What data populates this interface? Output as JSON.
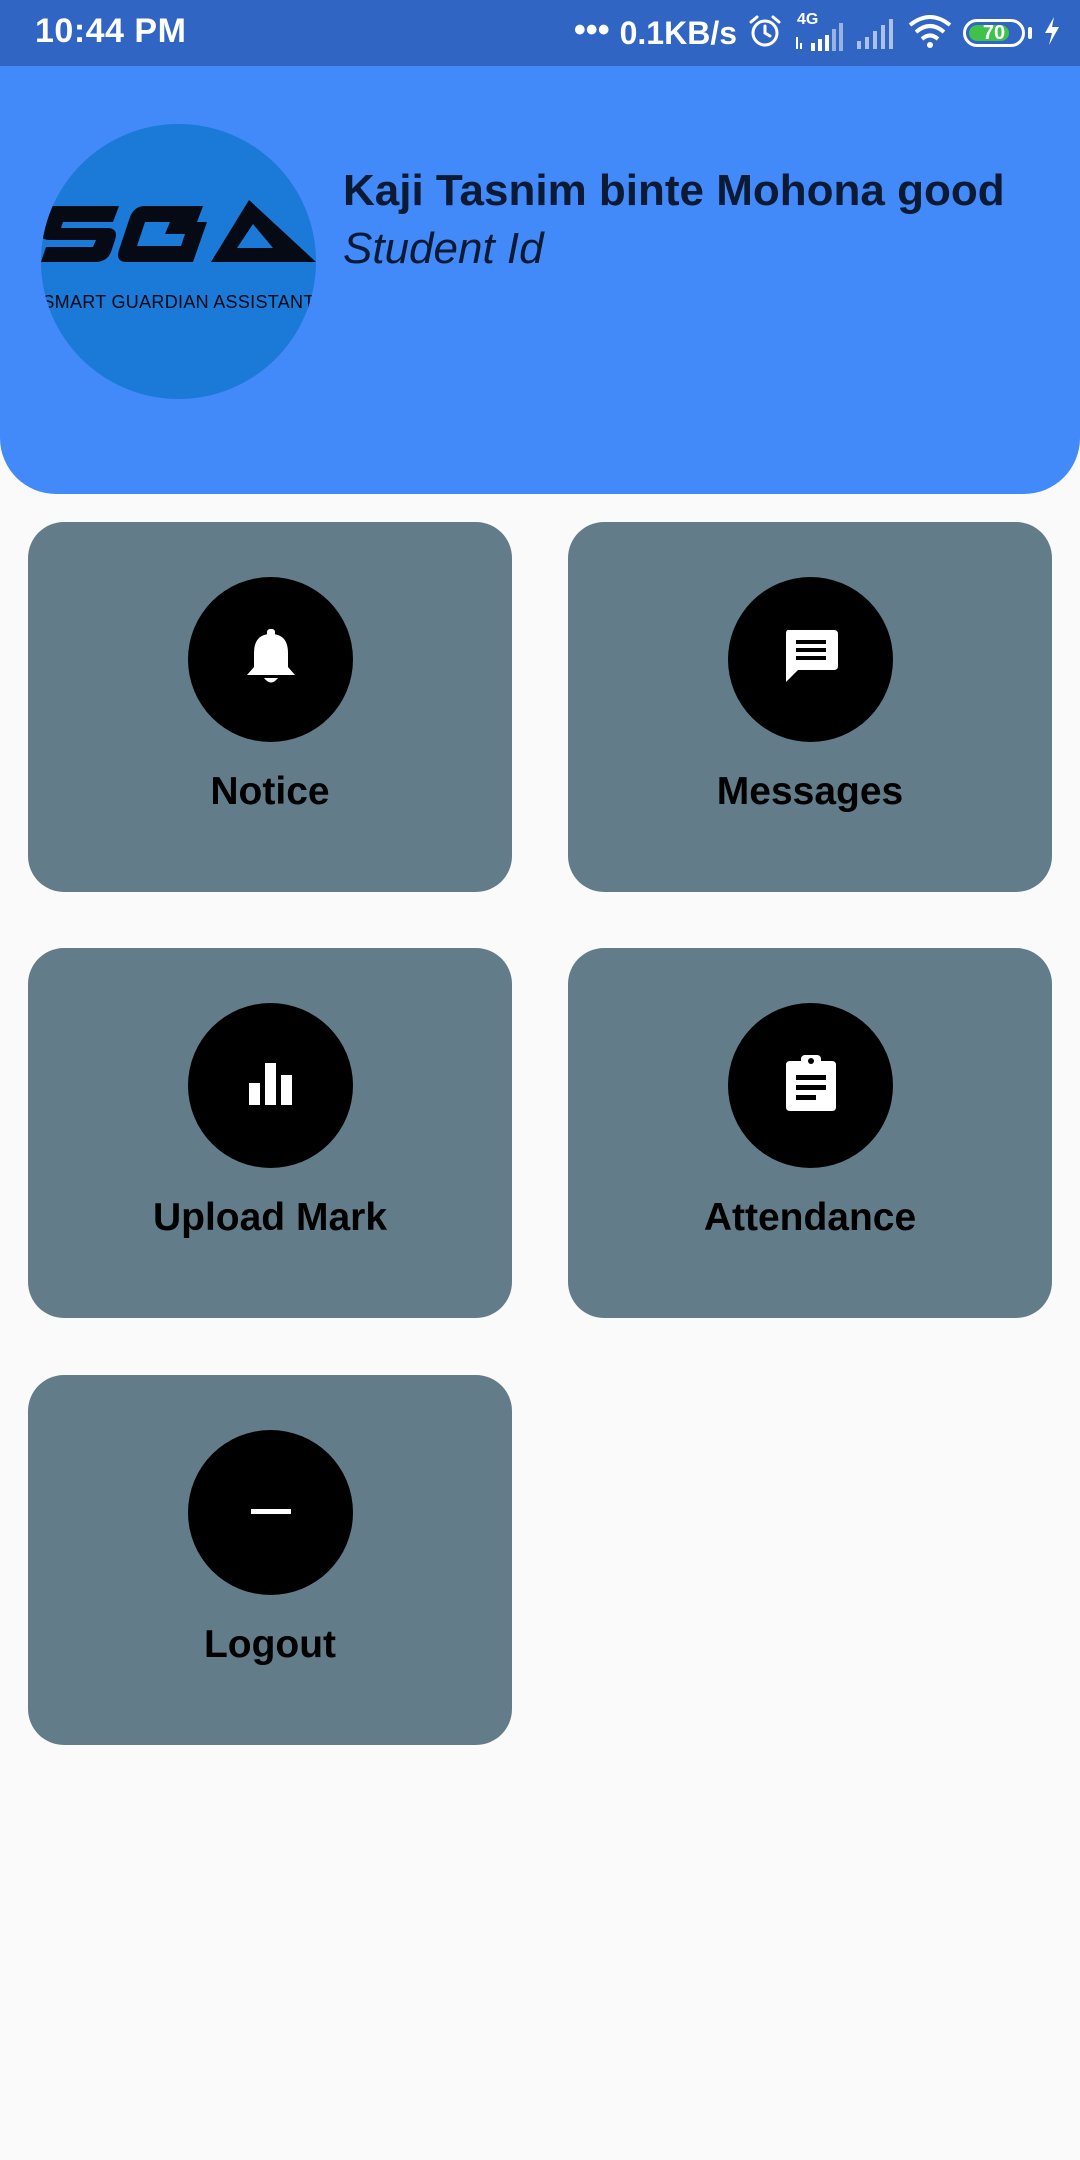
{
  "status_bar": {
    "time": "10:44 PM",
    "dots": "•••",
    "net_speed": "0.1KB/s",
    "network_type": "4G",
    "battery_level": "70",
    "icons": [
      "alarm-icon",
      "signal-icon",
      "wifi-icon",
      "battery-icon",
      "charging-icon"
    ]
  },
  "header": {
    "logo_caption": "SMART GUARDIAN ASSISTANT",
    "user_name": "Kaji Tasnim binte Mohona good",
    "subtitle": "Student Id"
  },
  "menu": [
    {
      "label": "Notice",
      "icon": "bell-icon"
    },
    {
      "label": "Messages",
      "icon": "message-icon"
    },
    {
      "label": "Upload Mark",
      "icon": "bar-chart-icon"
    },
    {
      "label": "Attendance",
      "icon": "clipboard-icon"
    },
    {
      "label": "Logout",
      "icon": "minus-icon"
    }
  ],
  "colors": {
    "status_bar": "#3165c4",
    "header": "#4289fa",
    "logo_circle": "#1b79d8",
    "card": "#627d89",
    "icon_circle": "#000000",
    "background": "#fafafa"
  }
}
